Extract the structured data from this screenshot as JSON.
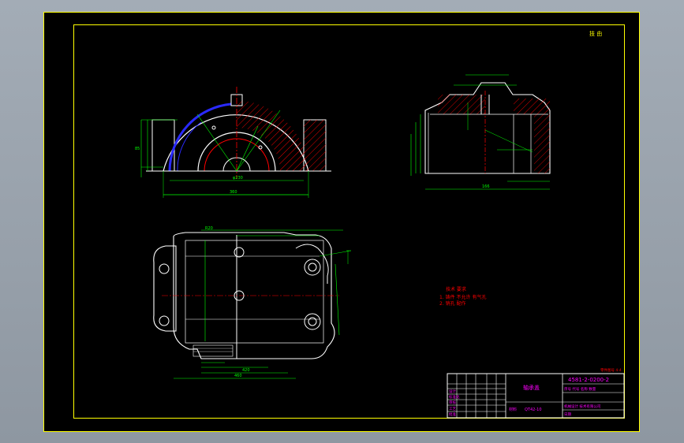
{
  "sheet_label": "技 由",
  "tech_requirements": {
    "title": "技术 要求",
    "item1": "1. 铸件 不允许 有气孔",
    "item2": "2. 销孔 配作"
  },
  "small_note": "零件图号 4-4",
  "title_block": {
    "drawing_number": "4581-2-0200-2",
    "part_name": "轴承盖",
    "material_label": "材料",
    "material": "QT42-10",
    "row1": "序号 代号 名称 数量",
    "company": "机械设计 技术有限公司",
    "cells": [
      "设计",
      "标准化",
      "审核",
      "工艺",
      "批准",
      "日期"
    ]
  },
  "dims": {
    "front_width": "360",
    "front_inner": "φ230",
    "front_height": "85",
    "side_width": "166",
    "plan_len1": "420",
    "plan_len2": "460",
    "plan_top": "R20"
  },
  "colors": {
    "outline": "#ffffff",
    "dimension": "#00ff00",
    "hatch": "#ff0000",
    "center": "#ff0000",
    "blue": "#2a2aff",
    "magenta": "#ff00ff",
    "yellow_frame": "#ffff00",
    "cyan": "#00ffff"
  }
}
